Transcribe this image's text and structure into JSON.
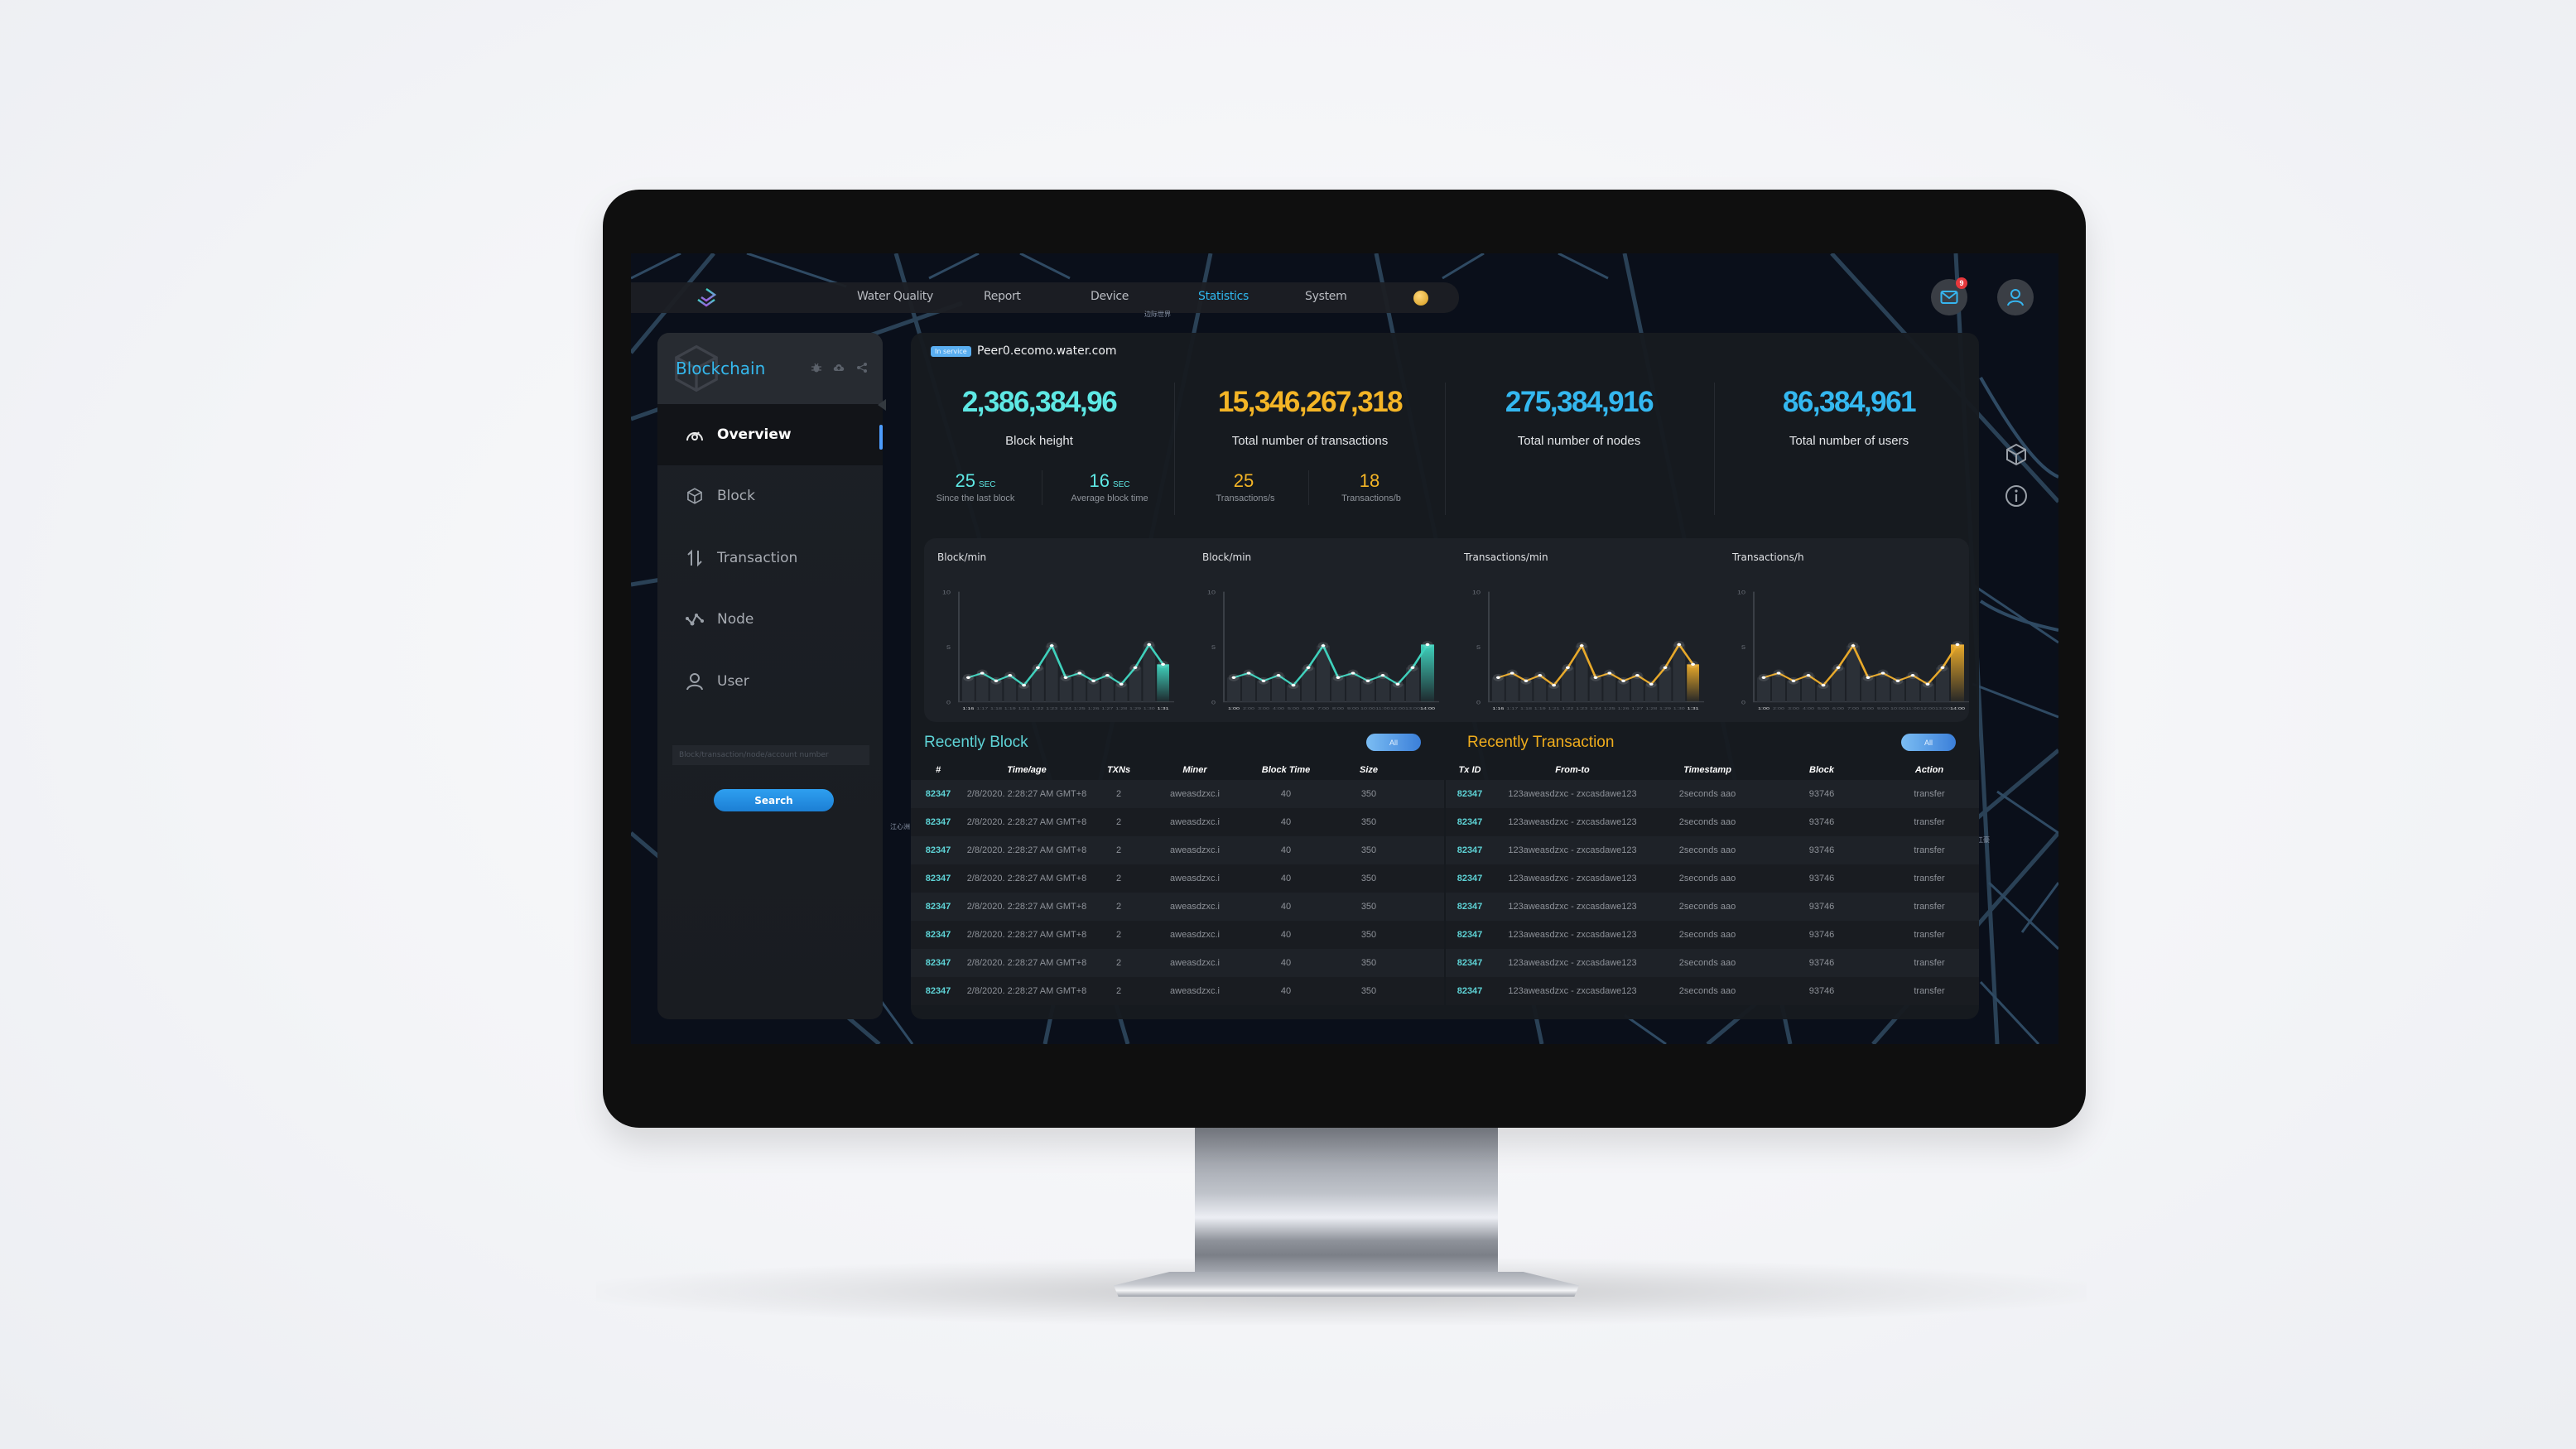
{
  "app": {
    "nav": [
      {
        "label": "Water Quality",
        "active": false
      },
      {
        "label": "Report",
        "active": false
      },
      {
        "label": "Device",
        "active": false
      },
      {
        "label": "Statistics",
        "active": true
      },
      {
        "label": "System",
        "active": false
      }
    ],
    "map_labels": [
      "边际世界",
      "江心洲",
      "江豪"
    ],
    "mail_badge": "9",
    "icons": {
      "logo": "layers-logo-icon",
      "coin": "coin-icon",
      "mail": "mail-icon",
      "user": "user-icon",
      "side_cube": "cube-icon",
      "side_info": "info-icon"
    }
  },
  "sidebar": {
    "title": "Blockchain",
    "tools": [
      "bug-icon",
      "cloud-upload-icon",
      "share-icon"
    ],
    "items": [
      {
        "label": "Overview",
        "icon": "gauge-icon",
        "active": true
      },
      {
        "label": "Block",
        "icon": "cube-icon",
        "active": false
      },
      {
        "label": "Transaction",
        "icon": "arrows-updown-icon",
        "active": false
      },
      {
        "label": "Node",
        "icon": "node-graph-icon",
        "active": false
      },
      {
        "label": "User",
        "icon": "user-icon",
        "active": false
      }
    ],
    "search_placeholder": "Block/transaction/node/account number",
    "search_value": "",
    "search_button": "Search"
  },
  "overview": {
    "status_badge": "In service",
    "peer": "Peer0.ecomo.water.com",
    "stats": [
      {
        "value": "2,386,384,96",
        "label": "Block height",
        "color": "#5ee8e4"
      },
      {
        "value": "15,346,267,318",
        "label": "Total number of transactions",
        "color": "#f4b526"
      },
      {
        "value": "275,384,916",
        "label": "Total number of nodes",
        "color": "#34b8f0"
      },
      {
        "value": "86,384,961",
        "label": "Total number of users",
        "color": "#34b8f0"
      }
    ],
    "substats": [
      {
        "value": "25",
        "unit": "SEC",
        "label": "Since the last block",
        "color": "#5ee8e4"
      },
      {
        "value": "16",
        "unit": "SEC",
        "label": "Average block time",
        "color": "#5ee8e4"
      },
      {
        "value": "25",
        "unit": "",
        "label": "Transactions/s",
        "color": "#f4b526"
      },
      {
        "value": "18",
        "unit": "",
        "label": "Transactions/b",
        "color": "#f4b526"
      }
    ]
  },
  "chart_data": [
    {
      "type": "bar",
      "title": "Block/min",
      "categories": [
        "1:16",
        "1:17",
        "1:18",
        "1:19",
        "1:21",
        "1:22",
        "1:23",
        "1:24",
        "1:25",
        "1:26",
        "1:27",
        "1:28",
        "1:29",
        "1:30",
        "1:31"
      ],
      "values": [
        2.2,
        2.6,
        1.9,
        2.4,
        1.5,
        3.1,
        5.1,
        2.2,
        2.6,
        1.9,
        2.4,
        1.6,
        3.1,
        5.2,
        3.4
      ],
      "ylim": [
        0,
        10
      ],
      "yticks": [
        0,
        5,
        10
      ],
      "color": "#3fd1bc",
      "highlight_last": true,
      "xlabel": "",
      "ylabel": ""
    },
    {
      "type": "bar",
      "title": "Block/min",
      "categories": [
        "1:00",
        "2:00",
        "3:00",
        "4:00",
        "5:00",
        "6:00",
        "7:00",
        "8:00",
        "9:00",
        "10:00",
        "11:00",
        "12:00",
        "13:00",
        "14:00"
      ],
      "values": [
        2.2,
        2.6,
        1.9,
        2.4,
        1.5,
        3.1,
        5.1,
        2.2,
        2.6,
        1.9,
        2.4,
        1.6,
        3.1,
        5.2
      ],
      "ylim": [
        0,
        10
      ],
      "yticks": [
        0,
        5,
        10
      ],
      "color": "#3fd1bc",
      "highlight_last": true,
      "xlabel": "",
      "ylabel": ""
    },
    {
      "type": "bar",
      "title": "Transactions/min",
      "categories": [
        "1:16",
        "1:17",
        "1:18",
        "1:19",
        "1:21",
        "1:22",
        "1:23",
        "1:24",
        "1:25",
        "1:26",
        "1:27",
        "1:28",
        "1:29",
        "1:30",
        "1:31"
      ],
      "values": [
        2.2,
        2.6,
        1.9,
        2.4,
        1.5,
        3.1,
        5.1,
        2.2,
        2.6,
        1.9,
        2.4,
        1.6,
        3.1,
        5.2,
        3.4
      ],
      "ylim": [
        0,
        10
      ],
      "yticks": [
        0,
        5,
        10
      ],
      "color": "#e8a92a",
      "highlight_last": true,
      "xlabel": "",
      "ylabel": ""
    },
    {
      "type": "bar",
      "title": "Transactions/h",
      "categories": [
        "1:00",
        "2:00",
        "3:00",
        "4:00",
        "5:00",
        "6:00",
        "7:00",
        "8:00",
        "9:00",
        "10:00",
        "11:00",
        "12:00",
        "13:00",
        "14:00"
      ],
      "values": [
        2.2,
        2.6,
        1.9,
        2.4,
        1.5,
        3.1,
        5.1,
        2.2,
        2.6,
        1.9,
        2.4,
        1.6,
        3.1,
        5.2
      ],
      "ylim": [
        0,
        10
      ],
      "yticks": [
        0,
        5,
        10
      ],
      "color": "#e8a92a",
      "highlight_last": true,
      "xlabel": "",
      "ylabel": ""
    }
  ],
  "recent_blocks": {
    "title": "Recently Block",
    "all_button": "All",
    "columns": [
      "#",
      "Time/age",
      "TXNs",
      "Miner",
      "Block Time",
      "Size"
    ],
    "rows": [
      [
        "82347",
        "2/8/2020. 2:28:27 AM GMT+8",
        "2",
        "aweasdzxc.i",
        "40",
        "350"
      ],
      [
        "82347",
        "2/8/2020. 2:28:27 AM GMT+8",
        "2",
        "aweasdzxc.i",
        "40",
        "350"
      ],
      [
        "82347",
        "2/8/2020. 2:28:27 AM GMT+8",
        "2",
        "aweasdzxc.i",
        "40",
        "350"
      ],
      [
        "82347",
        "2/8/2020. 2:28:27 AM GMT+8",
        "2",
        "aweasdzxc.i",
        "40",
        "350"
      ],
      [
        "82347",
        "2/8/2020. 2:28:27 AM GMT+8",
        "2",
        "aweasdzxc.i",
        "40",
        "350"
      ],
      [
        "82347",
        "2/8/2020. 2:28:27 AM GMT+8",
        "2",
        "aweasdzxc.i",
        "40",
        "350"
      ],
      [
        "82347",
        "2/8/2020. 2:28:27 AM GMT+8",
        "2",
        "aweasdzxc.i",
        "40",
        "350"
      ],
      [
        "82347",
        "2/8/2020. 2:28:27 AM GMT+8",
        "2",
        "aweasdzxc.i",
        "40",
        "350"
      ]
    ]
  },
  "recent_transactions": {
    "title": "Recently Transaction",
    "all_button": "All",
    "columns": [
      "Tx ID",
      "From-to",
      "Timestamp",
      "Block",
      "Action"
    ],
    "rows": [
      [
        "82347",
        "123aweasdzxc - zxcasdawe123",
        "2seconds aao",
        "93746",
        "transfer"
      ],
      [
        "82347",
        "123aweasdzxc - zxcasdawe123",
        "2seconds aao",
        "93746",
        "transfer"
      ],
      [
        "82347",
        "123aweasdzxc - zxcasdawe123",
        "2seconds aao",
        "93746",
        "transfer"
      ],
      [
        "82347",
        "123aweasdzxc - zxcasdawe123",
        "2seconds aao",
        "93746",
        "transfer"
      ],
      [
        "82347",
        "123aweasdzxc - zxcasdawe123",
        "2seconds aao",
        "93746",
        "transfer"
      ],
      [
        "82347",
        "123aweasdzxc - zxcasdawe123",
        "2seconds aao",
        "93746",
        "transfer"
      ],
      [
        "82347",
        "123aweasdzxc - zxcasdawe123",
        "2seconds aao",
        "93746",
        "transfer"
      ],
      [
        "82347",
        "123aweasdzxc - zxcasdawe123",
        "2seconds aao",
        "93746",
        "transfer"
      ]
    ]
  }
}
